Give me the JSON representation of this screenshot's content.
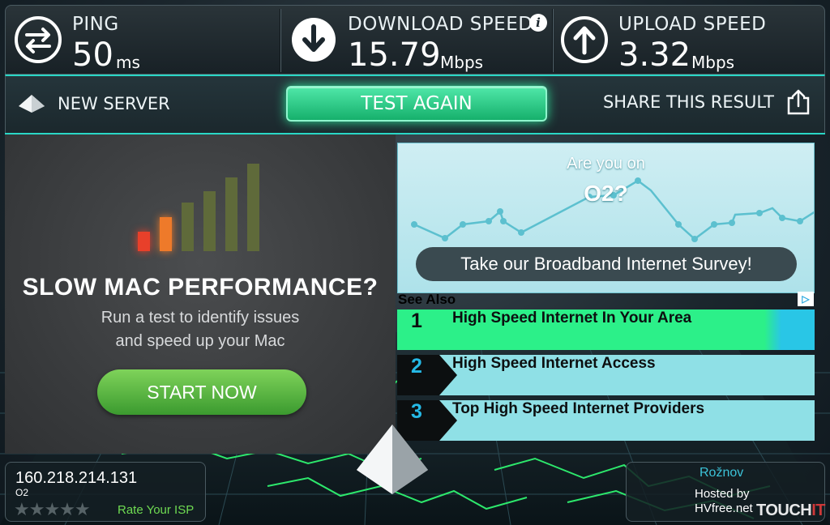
{
  "metrics": {
    "ping": {
      "label": "PING",
      "value": "50",
      "unit": "ms",
      "icon": "ping-arrows-icon"
    },
    "download": {
      "label": "DOWNLOAD SPEED",
      "value": "15.79",
      "unit": "Mbps",
      "icon": "download-arrow-icon",
      "info": "i"
    },
    "upload": {
      "label": "UPLOAD SPEED",
      "value": "3.32",
      "unit": "Mbps",
      "icon": "upload-arrow-icon"
    }
  },
  "actions": {
    "new_server": "NEW SERVER",
    "test_again": "TEST AGAIN",
    "share": "SHARE THIS RESULT"
  },
  "ad_left": {
    "headline": "SLOW MAC PERFORMANCE?",
    "sub_line1": "Run a test to identify issues",
    "sub_line2": "and speed up your Mac",
    "button": "START NOW",
    "signal_levels": [
      0.2,
      0.35,
      0.5,
      0.62,
      0.76,
      0.9
    ],
    "signal_colors": [
      "#e8402a",
      "#ee7a2a",
      "#5f6a3a",
      "#5f6a3a",
      "#5f6a3a",
      "#5f6a3a"
    ]
  },
  "ad_right": {
    "question_line1": "Are you on",
    "question_line2": "O2?",
    "survey_button": "Take our Broadband Internet Survey!"
  },
  "see_also": {
    "title": "See Also",
    "adchoice": "▷",
    "links": [
      {
        "num": "1",
        "text": "High Speed Internet In Your Area"
      },
      {
        "num": "2",
        "text": "High Speed Internet Access"
      },
      {
        "num": "3",
        "text": "Top High Speed Internet Providers"
      }
    ]
  },
  "client": {
    "ip": "160.218.214.131",
    "isp": "O2",
    "stars": "★★★★★",
    "rate_label": "Rate Your ISP"
  },
  "server": {
    "city": "Rožnov",
    "hosted_by": "Hosted by",
    "host": "HVfree.net"
  },
  "watermark": {
    "part1": "TOUCH",
    "part2": "IT"
  },
  "colors": {
    "accent": "#2ad7c6",
    "button_green": "#16b06c",
    "map_green": "#2de86c"
  }
}
